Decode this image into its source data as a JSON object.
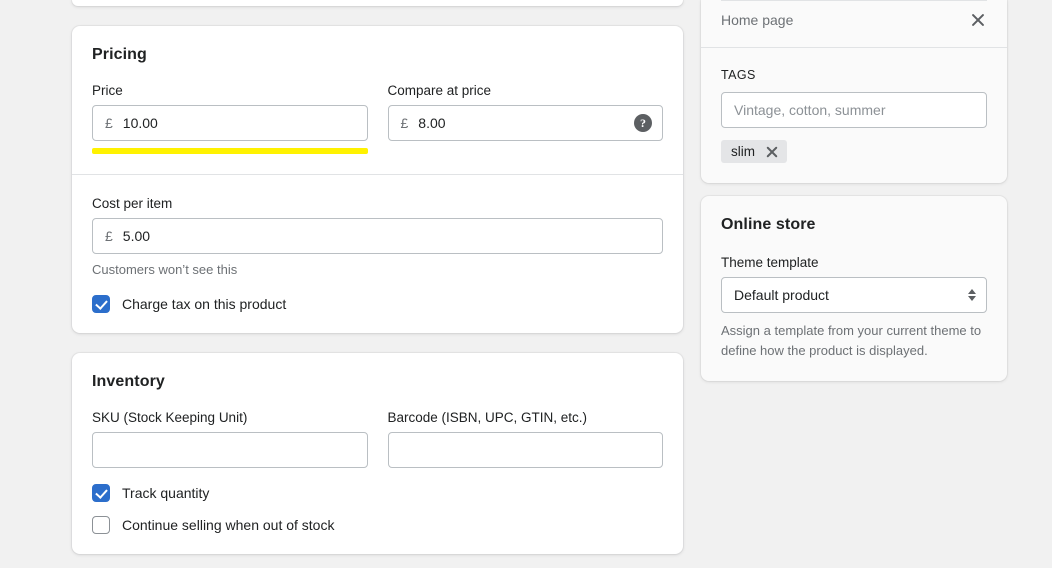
{
  "pricing": {
    "title": "Pricing",
    "price": {
      "label": "Price",
      "currency": "£",
      "value": "10.00"
    },
    "compare_at_price": {
      "label": "Compare at price",
      "currency": "£",
      "value": "8.00",
      "help_icon": "help-circle-icon"
    },
    "cost_per_item": {
      "label": "Cost per item",
      "currency": "£",
      "value": "5.00",
      "help_text": "Customers won’t see this"
    },
    "charge_tax": {
      "label": "Charge tax on this product",
      "checked": true
    },
    "highlight_color": "#fff200"
  },
  "inventory": {
    "title": "Inventory",
    "sku": {
      "label": "SKU (Stock Keeping Unit)",
      "value": ""
    },
    "barcode": {
      "label": "Barcode (ISBN, UPC, GTIN, etc.)",
      "value": ""
    },
    "track_quantity": {
      "label": "Track quantity",
      "checked": true
    },
    "continue_selling": {
      "label": "Continue selling when out of stock",
      "checked": false
    }
  },
  "sidebar": {
    "home_page_row": {
      "label": "Home page",
      "close_icon": "close-icon"
    },
    "tags": {
      "caption": "TAGS",
      "input_placeholder": "Vintage, cotton, summer",
      "input_value": "",
      "chips": [
        {
          "label": "slim",
          "remove_icon": "close-icon"
        }
      ]
    },
    "online_store": {
      "title": "Online store",
      "theme_template": {
        "label": "Theme template",
        "value": "Default product"
      },
      "help_text": "Assign a template from your current theme to define how the product is displayed."
    }
  },
  "theme": {
    "accent": "#2c6ecb",
    "page_bg": "#f1f1f1",
    "card_bg": "#ffffff",
    "panel_bg": "#fafafa"
  }
}
